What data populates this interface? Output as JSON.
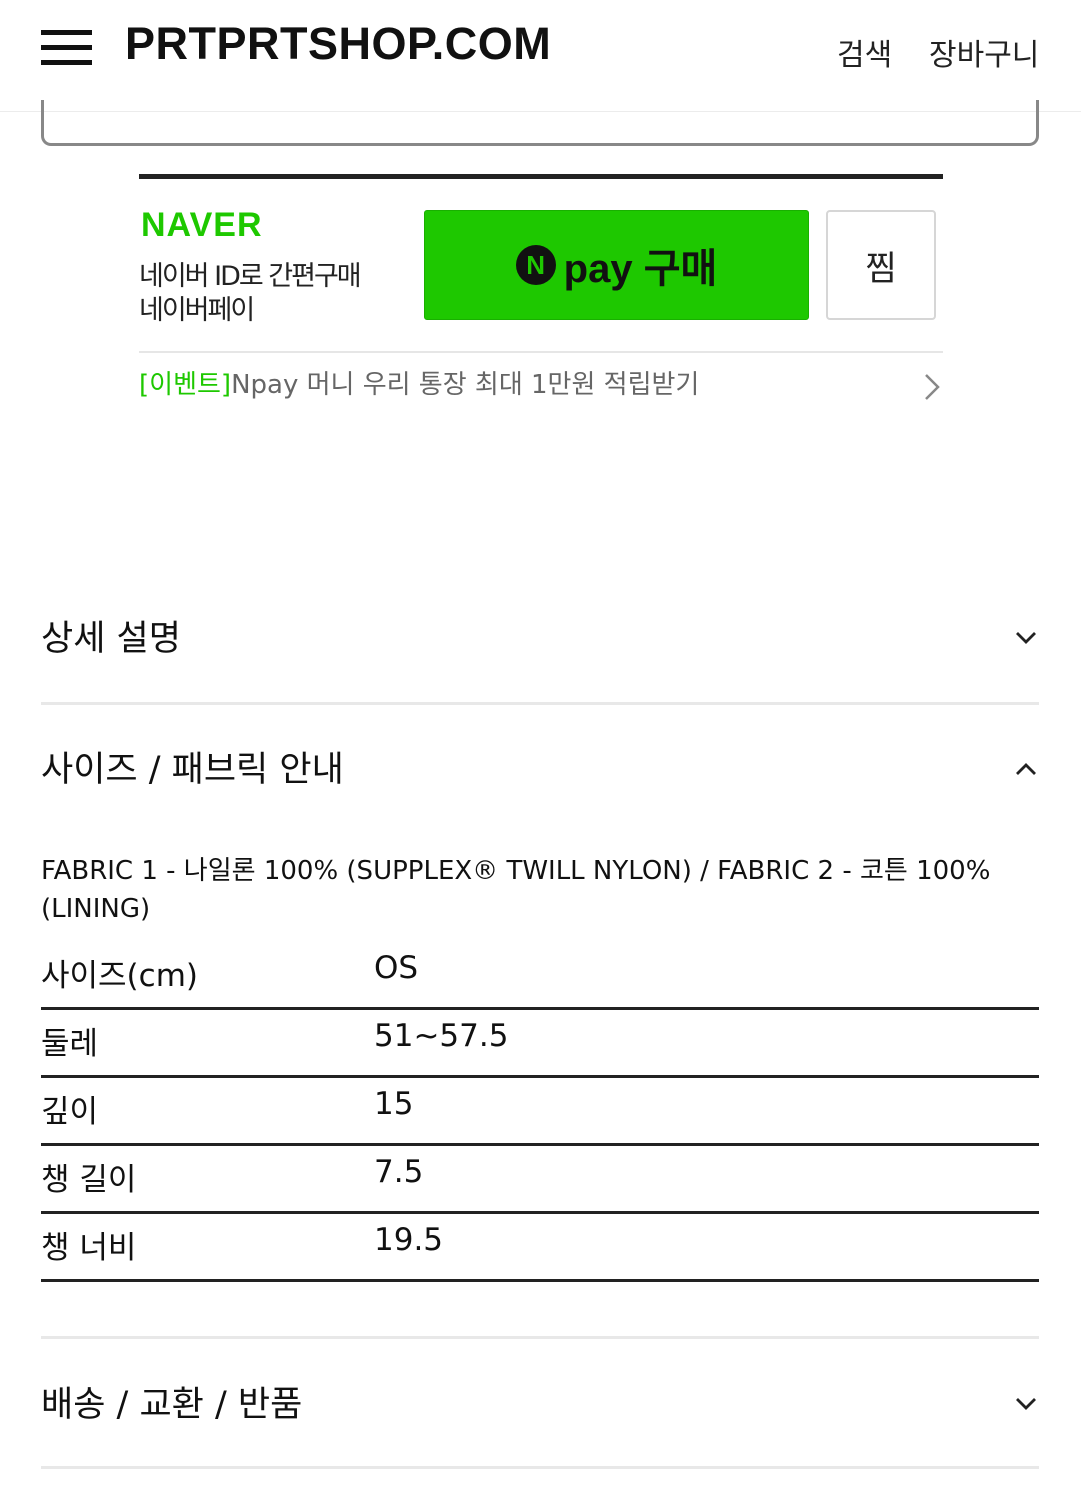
{
  "header": {
    "logo": "PRTPRTSHOP.COM",
    "search_label": "검색",
    "cart_label": "장바구니"
  },
  "naver_pay": {
    "brand": "NAVER",
    "line1": "네이버 ID로 간편구매",
    "line2": "네이버페이",
    "pay_button": {
      "n": "N",
      "label": "pay 구매"
    },
    "wish_label": "찜",
    "event_tag": "[이벤트]",
    "event_text": "Npay 머니 우리 통장 최대 1만원 적립받기",
    "accent_color": "#1ec800"
  },
  "accordion": {
    "detail_title": "상세 설명",
    "size_title": "사이즈 / 패브릭 안내",
    "shipping_title": "배송 / 교환 / 반품"
  },
  "fabric_text": "FABRIC 1 - 나일론 100% (SUPPLEX® TWILL NYLON) / FABRIC 2 - 코튼 100% (LINING)",
  "size_table": {
    "header": {
      "label": "사이즈(cm)",
      "value": "OS"
    },
    "rows": [
      {
        "label": "둘레",
        "value": "51~57.5"
      },
      {
        "label": "깊이",
        "value": "15"
      },
      {
        "label": "챙 길이",
        "value": "7.5"
      },
      {
        "label": "챙 너비",
        "value": "19.5"
      }
    ]
  }
}
